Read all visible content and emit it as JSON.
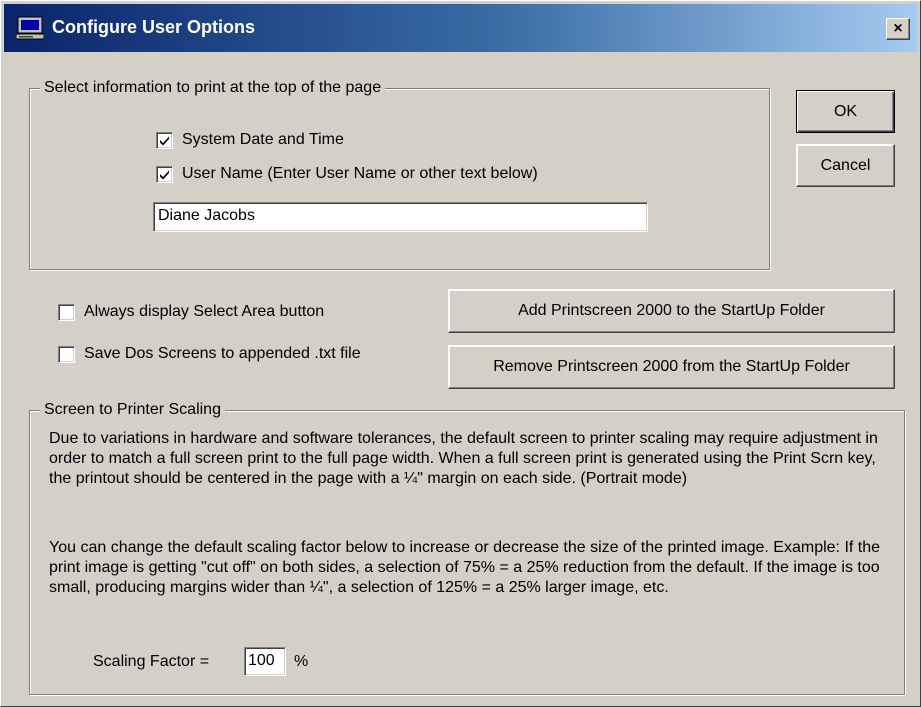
{
  "window": {
    "title": "Configure User Options",
    "close_label": "×",
    "icon": "monitor-icon"
  },
  "header_group": {
    "legend": "Select information to print at the top of the page",
    "system_date": {
      "label": "System Date and Time",
      "checked": true
    },
    "user_name": {
      "label": "User Name (Enter User Name or other text below)",
      "checked": true
    },
    "user_name_value": "Diane Jacobs"
  },
  "buttons": {
    "ok": "OK",
    "cancel": "Cancel",
    "add_startup": "Add Printscreen 2000 to the StartUp Folder",
    "remove_startup": "Remove Printscreen 2000 from the StartUp Folder"
  },
  "options": {
    "select_area": {
      "label": "Always display Select Area button",
      "checked": false
    },
    "dos_screens": {
      "label": "Save Dos Screens to appended .txt file",
      "checked": false
    }
  },
  "scaling_group": {
    "legend": "Screen to Printer Scaling",
    "paragraph1": "Due to variations in hardware and software tolerances, the default screen to printer scaling may require adjustment in order to match a full screen print to the full page width. When a full screen print is generated using the Print Scrn key, the printout should be centered in the page with a ¼\" margin on each side. (Portrait mode)",
    "paragraph2": "You can change the default scaling factor below to increase or decrease the size of the printed image.  Example: If the print image is getting \"cut off\" on both sides, a selection of 75% = a 25% reduction from the default. If the image is too small, producing margins wider than ¼\", a selection of 125% = a 25% larger image, etc.",
    "factor_label": "Scaling Factor =",
    "factor_value": "100",
    "factor_unit": "%"
  }
}
